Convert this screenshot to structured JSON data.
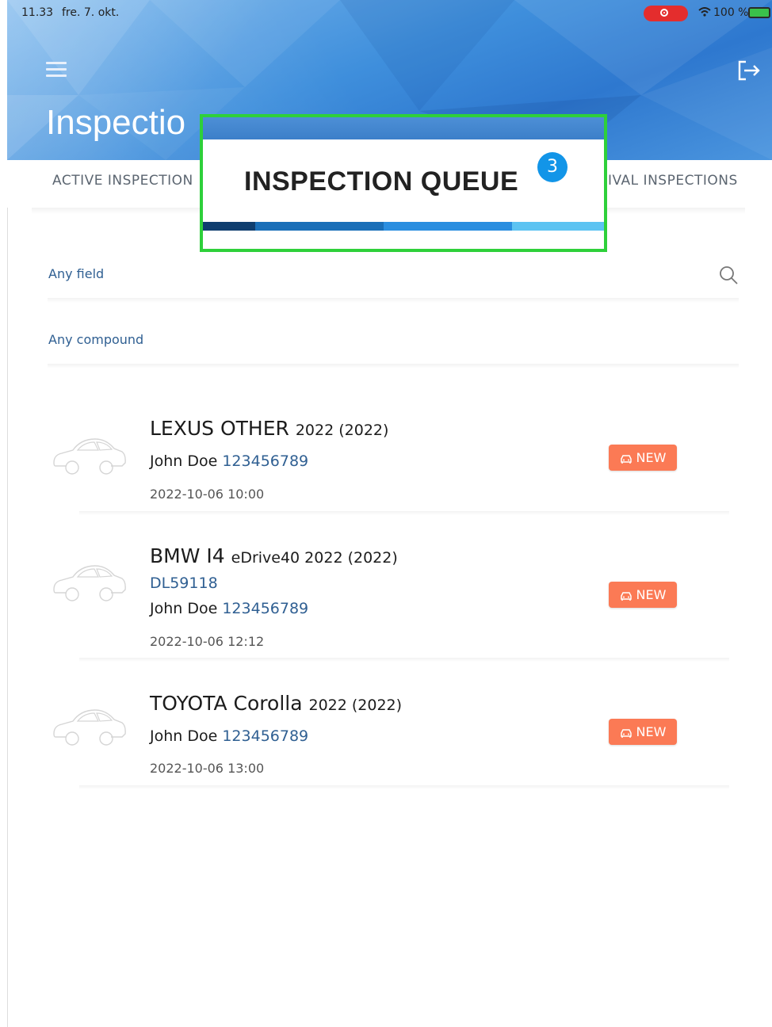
{
  "status_bar": {
    "time": "11.33",
    "date": "fre. 7. okt.",
    "battery": "100 %"
  },
  "header": {
    "title": "Inspectio"
  },
  "tabs": {
    "left": "ACTIVE INSPECTION",
    "right": "IVAL INSPECTIONS"
  },
  "popup": {
    "title": "INSPECTION QUEUE",
    "badge": "3"
  },
  "filters": {
    "field": "Any field",
    "compound": "Any compound"
  },
  "items": [
    {
      "make": "LEXUS OTHER",
      "sub": "2022 (2022)",
      "plate": "",
      "owner": "John Doe",
      "phone": "123456789",
      "date": "2022-10-06 10:00",
      "status": "NEW"
    },
    {
      "make": "BMW I4",
      "sub": "eDrive40 2022 (2022)",
      "plate": "DL59118",
      "owner": "John Doe",
      "phone": "123456789",
      "date": "2022-10-06 12:12",
      "status": "NEW"
    },
    {
      "make": "TOYOTA Corolla",
      "sub": "2022 (2022)",
      "plate": "",
      "owner": "John Doe",
      "phone": "123456789",
      "date": "2022-10-06 13:00",
      "status": "NEW"
    }
  ],
  "colors": {
    "accent": "#2f5f92",
    "badge": "#fb7a55",
    "highlight": "#2ed03a",
    "queue_badge": "#1295e8"
  },
  "icons": [
    "menu-icon",
    "logout-icon",
    "search-icon",
    "car-icon",
    "record-icon",
    "wifi-icon",
    "battery-icon"
  ]
}
